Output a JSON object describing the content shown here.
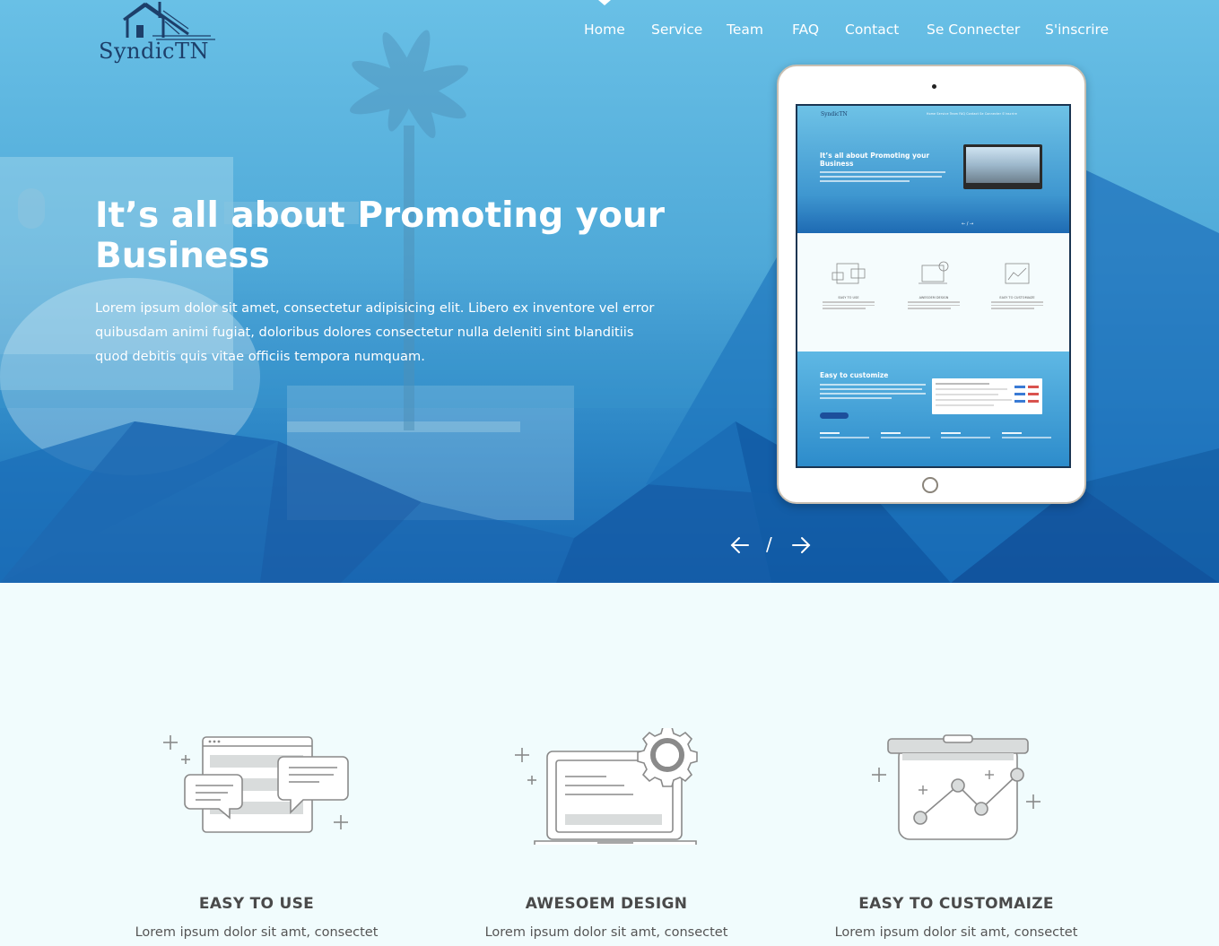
{
  "brand": {
    "name": "SyndicTN"
  },
  "nav": {
    "items": [
      "Home",
      "Service",
      "Team",
      "FAQ",
      "Contact",
      "Se Connecter",
      "S'inscrire"
    ],
    "active": "Home"
  },
  "hero": {
    "title": "It’s all about Promoting your Business",
    "text": "Lorem ipsum dolor sit amet, consectetur adipisicing elit. Libero ex inventore vel error quibusdam animi fugiat, doloribus dolores consectetur nulla deleniti sint blanditiis quod debitis quis vitae officiis tempora numquam.",
    "slider_separator": "/"
  },
  "tablet_preview": {
    "logo": "SyndicTN",
    "nav": "Home   Service   Team   FAQ   Contact   Se Connecter   S'inscrire",
    "title": "It’s all about Promoting your Business",
    "arrows": "← / →",
    "features": [
      "EASY TO USE",
      "AWESOEM DESIGN",
      "EASY TO CUSTOMAIZE"
    ],
    "customize_title": "Easy to customize"
  },
  "features": [
    {
      "title": "EASY TO USE",
      "text": "Lorem ipsum dolor sit amt, consectet",
      "icon": "chat-window-icon"
    },
    {
      "title": "AWESOEM DESIGN",
      "text": "Lorem ipsum dolor sit amt, consectet",
      "icon": "laptop-gear-icon"
    },
    {
      "title": "EASY TO CUSTOMAIZE",
      "text": "Lorem ipsum dolor sit amt, consectet",
      "icon": "chart-board-icon"
    }
  ],
  "colors": {
    "hero_top": "#69c0e6",
    "hero_bottom": "#1667b3",
    "logo": "#1d3f6a",
    "section_bg": "#f1fcfd",
    "feature_title": "#4a4a4a"
  }
}
